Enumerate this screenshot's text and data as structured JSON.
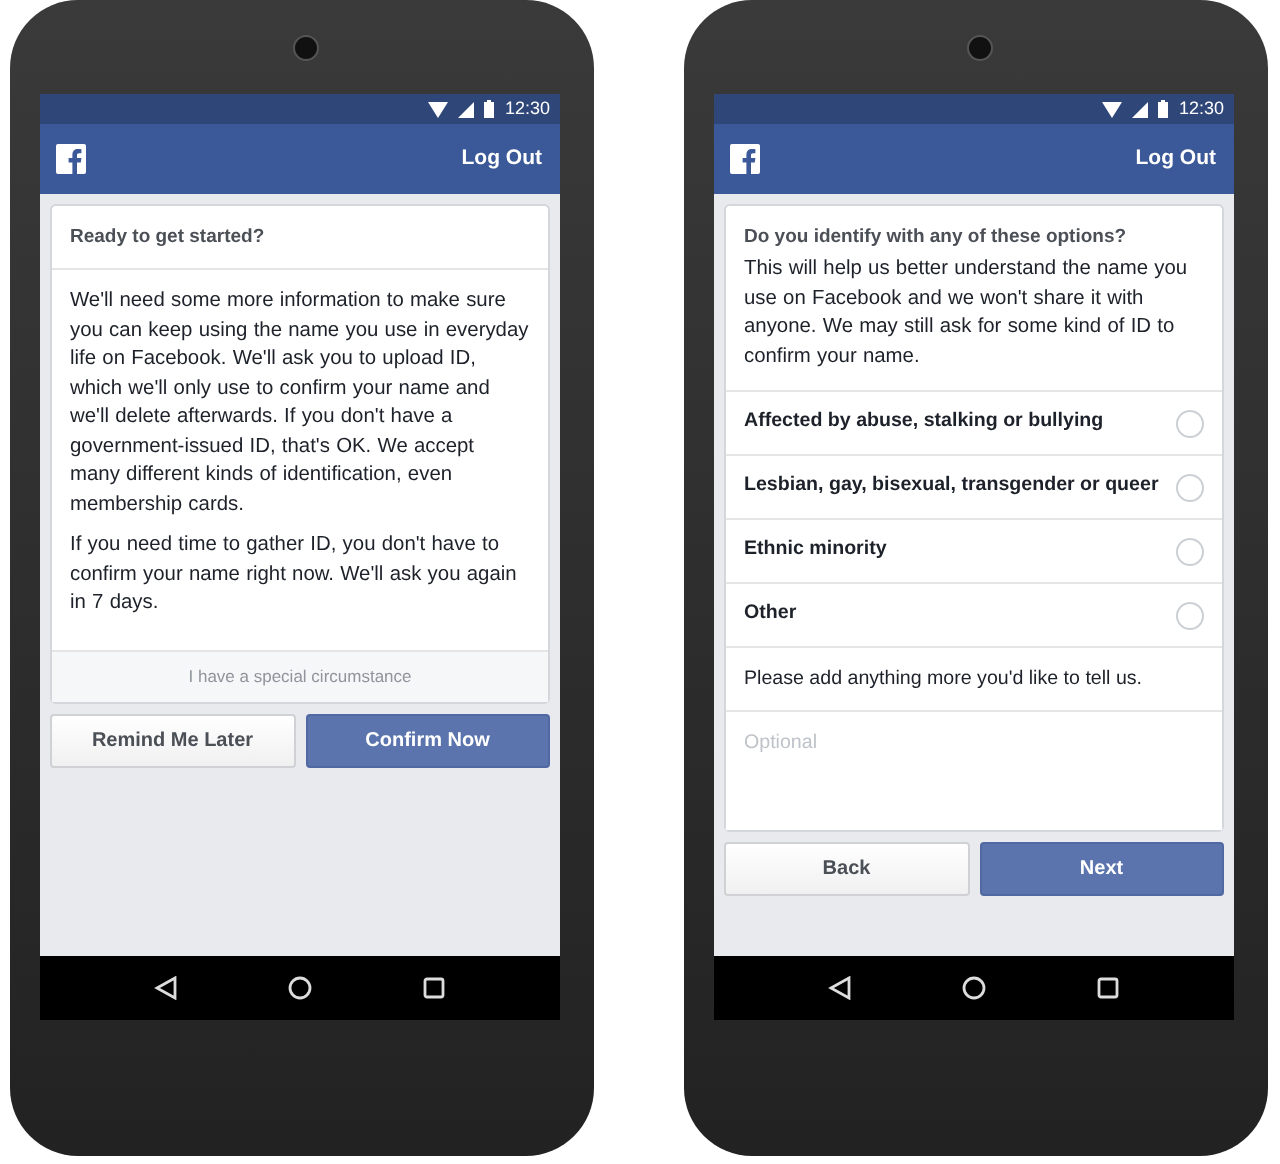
{
  "phones": [
    {
      "status_bar": {
        "time": "12:30"
      },
      "app_bar": {
        "action": "Log Out"
      },
      "card": {
        "kind": "intro",
        "title": "Ready to get started?",
        "paragraphs": [
          "We'll need some more information to make sure you can keep using the name you use in everyday life on Facebook. We'll ask you to upload ID, which we'll only use to confirm your name and we'll delete afterwards. If you don't have a government-issued ID, that's OK. We accept many different kinds of identification, even membership cards.",
          "If you need time to gather ID, you don't have to confirm your name right now. We'll ask you again in 7 days."
        ],
        "footer_link": "I have a special circumstance"
      },
      "buttons": [
        {
          "label": "Remind Me Later",
          "primary": false
        },
        {
          "label": "Confirm Now",
          "primary": true
        }
      ]
    },
    {
      "status_bar": {
        "time": "12:30"
      },
      "app_bar": {
        "action": "Log Out"
      },
      "card": {
        "kind": "options",
        "title": "Do you identify with any of these options?",
        "description": "This will help us better understand the name you use on Facebook and we won't share it with anyone. We may still ask for some kind of ID to confirm your name.",
        "options": [
          {
            "label": "Affected by abuse, stalking or bullying",
            "selected": false
          },
          {
            "label": "Lesbian, gay, bisexual, transgender or queer",
            "selected": false
          },
          {
            "label": "Ethnic minority",
            "selected": false
          },
          {
            "label": "Other",
            "selected": false
          }
        ],
        "prompt": "Please add anything more you'd like to tell us.",
        "field": {
          "placeholder": "Optional"
        }
      },
      "buttons": [
        {
          "label": "Back",
          "primary": false
        },
        {
          "label": "Next",
          "primary": true
        }
      ]
    }
  ]
}
